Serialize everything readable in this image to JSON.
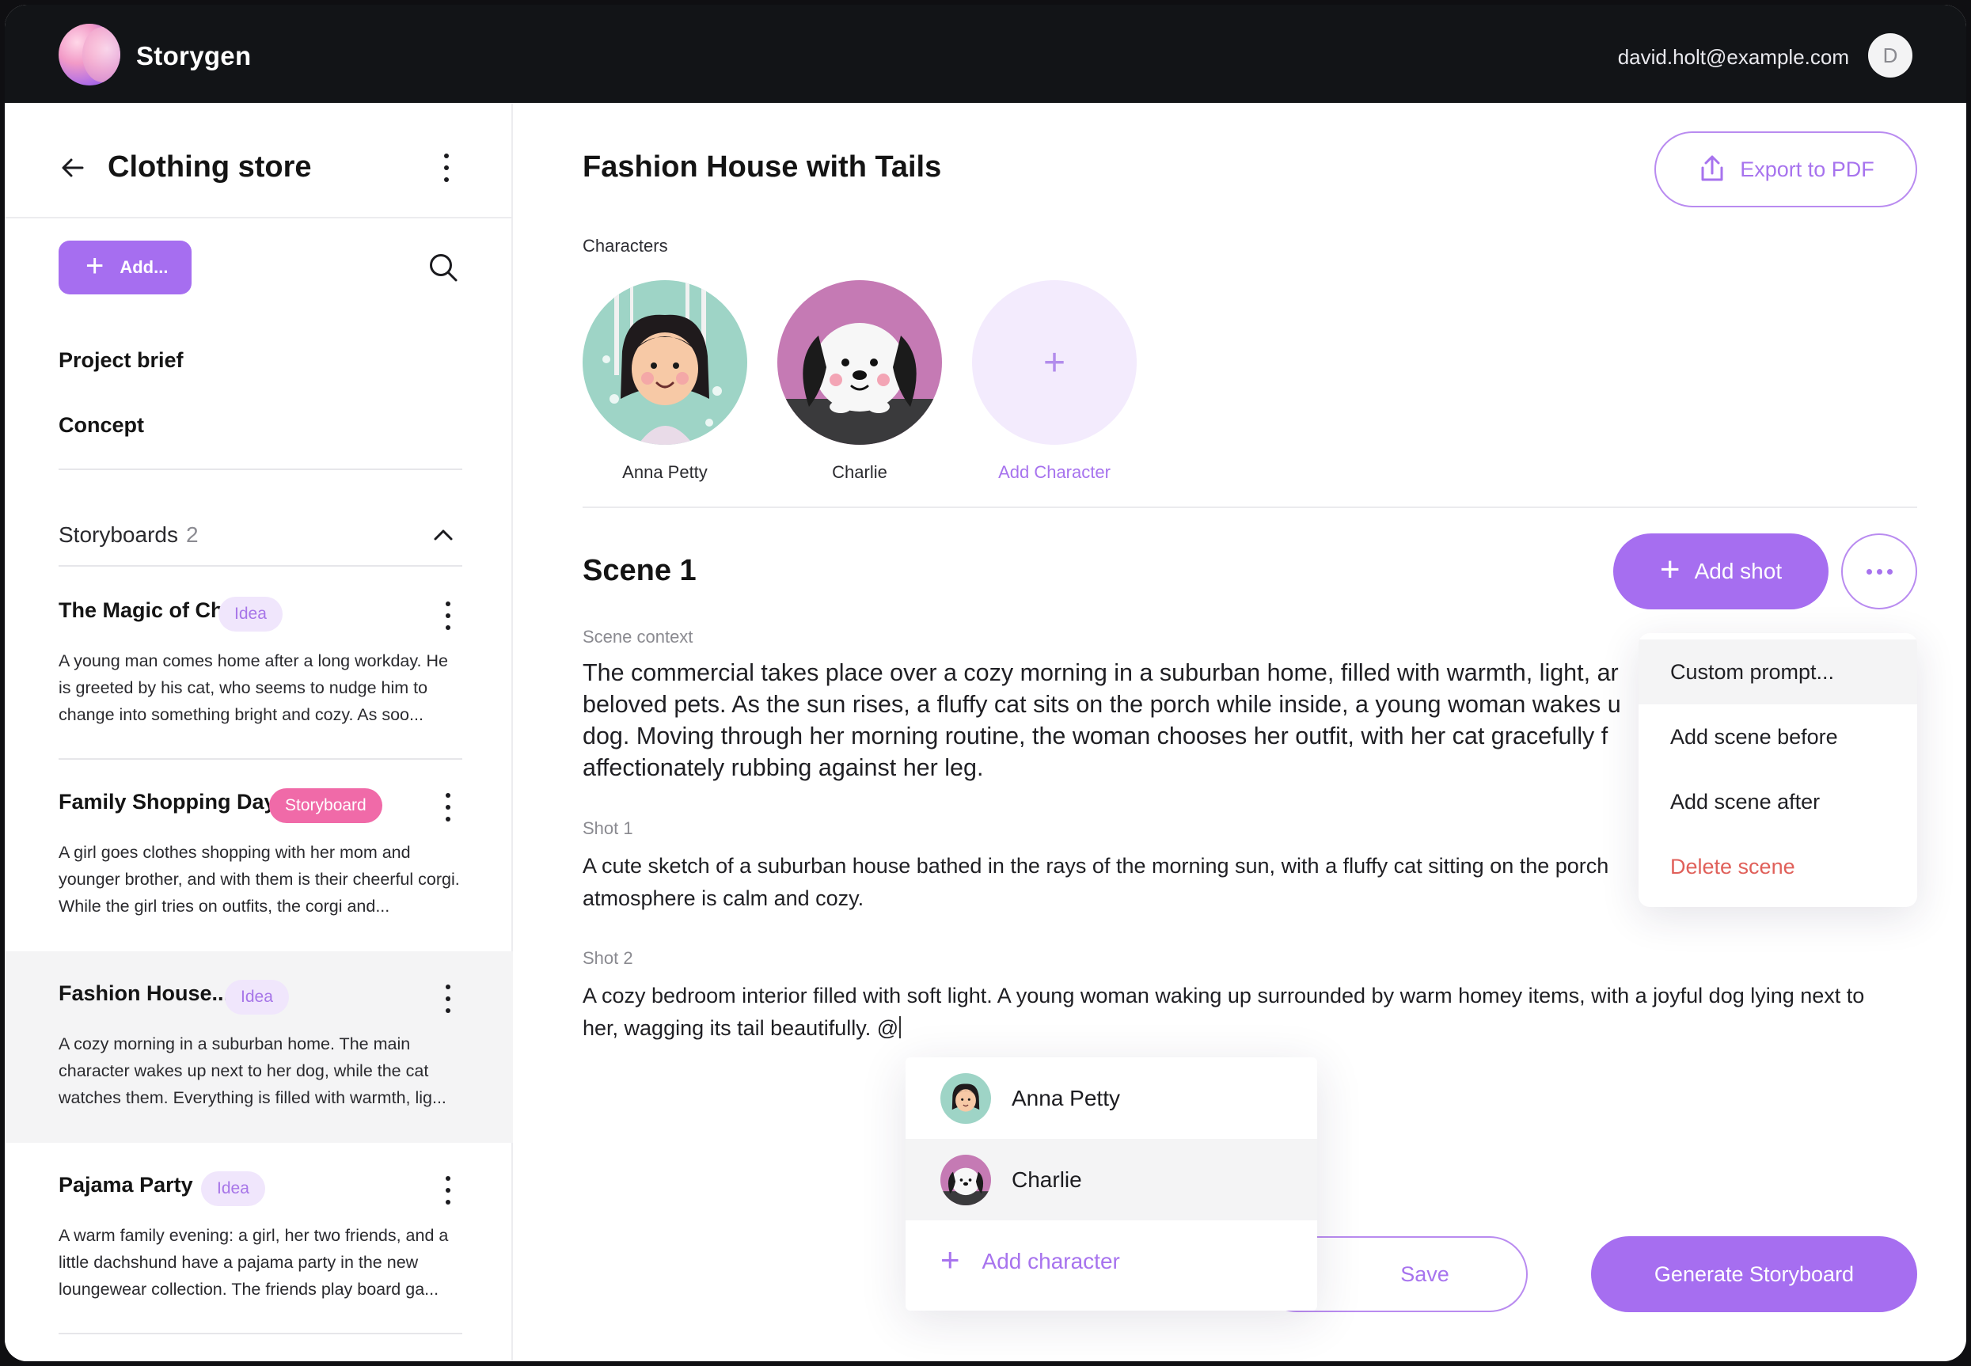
{
  "header": {
    "app_name": "Storygen",
    "user_email": "david.holt@example.com",
    "avatar_initial": "D"
  },
  "sidebar": {
    "project_title": "Clothing store",
    "add_label": "Add...",
    "nav": [
      {
        "label": "Project brief"
      },
      {
        "label": "Concept"
      }
    ],
    "storyboards_label": "Storyboards",
    "storyboards_count": "2",
    "stories": [
      {
        "title": "The Magic of Change",
        "badge": "Idea",
        "desc": "A young man comes home after a long workday. He is greeted by his cat, who seems to nudge him to change into something bright and cozy. As soo..."
      },
      {
        "title": "Family Shopping Day",
        "badge": "Storyboard",
        "desc": "A girl goes clothes shopping with her mom and younger brother, and with them is their cheerful corgi. While the girl tries on outfits, the corgi and..."
      },
      {
        "title": "Fashion House...",
        "badge": "Idea",
        "desc": "A cozy morning in a suburban home. The main character wakes up next to her dog, while the cat watches them. Everything is filled with warmth, lig..."
      },
      {
        "title": "Pajama Party",
        "badge": "Idea",
        "desc": "A warm family evening: a girl, her two friends, and a little dachshund have a pajama party in the new loungewear collection. The friends play board ga..."
      }
    ]
  },
  "main": {
    "title": "Fashion House with Tails",
    "export_label": "Export to PDF",
    "characters_label": "Characters",
    "characters": [
      {
        "name": "Anna Petty"
      },
      {
        "name": "Charlie"
      }
    ],
    "add_character_label": "Add Character",
    "scene_title": "Scene 1",
    "add_shot_label": "Add shot",
    "scene_context_label": "Scene context",
    "scene_context_lines": [
      "The commercial takes place over a cozy morning in a suburban home, filled with warmth, light, ar",
      "beloved pets. As the sun rises, a fluffy cat sits on the porch while inside, a young woman wakes u",
      "dog. Moving through her morning routine, the woman chooses her outfit, with her cat gracefully f",
      "affectionately rubbing against her leg."
    ],
    "shot1_label": "Shot 1",
    "shot1_lines": [
      "A cute sketch of a suburban house bathed in the rays of the morning sun, with a fluffy cat sitting on the porch",
      "atmosphere is calm and cozy."
    ],
    "shot2_label": "Shot 2",
    "shot2_lines": [
      "A cozy bedroom interior filled with soft light. A young woman waking up surrounded by warm homey items, with a joyful dog lying next to",
      "her, wagging its tail beautifully. @"
    ],
    "save_label": "Save",
    "generate_label": "Generate Storyboard"
  },
  "scene_menu": {
    "items": [
      {
        "label": "Custom prompt..."
      },
      {
        "label": "Add scene before"
      },
      {
        "label": "Add scene after"
      },
      {
        "label": "Delete scene"
      }
    ]
  },
  "mention_menu": {
    "items": [
      {
        "label": "Anna Petty"
      },
      {
        "label": "Charlie"
      }
    ],
    "add_label": "Add character"
  },
  "colors": {
    "accent": "#a66ef0",
    "accent_light": "#f0e6fc",
    "badge_storyboard": "#f06aa8",
    "danger": "#e0605a",
    "header_bg": "#121417"
  }
}
